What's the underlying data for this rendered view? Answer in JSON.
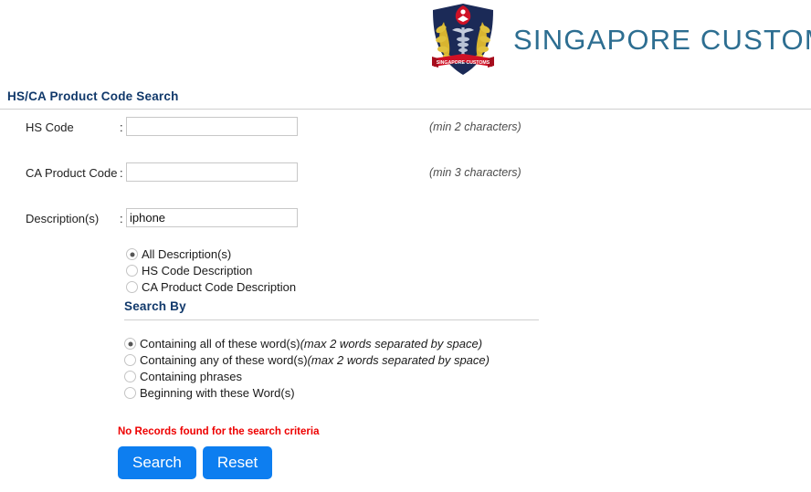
{
  "brand": {
    "name": "SINGAPORE CUSTOMS",
    "crest_icon": "singapore-customs-crest-icon",
    "crest_banner_text": "SINGAPORE CUSTOMS",
    "accent_color": "#2d6e91"
  },
  "page": {
    "title": "HS/CA Product Code Search",
    "heading_color": "#11396b"
  },
  "form": {
    "fields": [
      {
        "label": "HS Code",
        "separator": ":",
        "value": "",
        "placeholder": "",
        "hint": "(min 2 characters)"
      },
      {
        "label": "CA Product Code",
        "separator": ":",
        "value": "",
        "placeholder": "",
        "hint": "(min 3 characters)"
      },
      {
        "label": "Description(s)",
        "separator": ":",
        "value": "iphone",
        "placeholder": "",
        "hint": ""
      }
    ],
    "description_scope": {
      "options": [
        {
          "label": "All Description(s)",
          "checked": true
        },
        {
          "label": "HS Code Description",
          "checked": false
        },
        {
          "label": "CA Product Code Description",
          "checked": false
        }
      ]
    }
  },
  "search_by": {
    "title": "Search By",
    "options": [
      {
        "label": "Containing all of these word(s)",
        "hint": "(max 2 words separated by space)",
        "checked": true
      },
      {
        "label": "Containing any of these word(s)",
        "hint": "(max 2 words separated by space)",
        "checked": false
      },
      {
        "label": "Containing phrases",
        "hint": "",
        "checked": false
      },
      {
        "label": "Beginning with these Word(s)",
        "hint": "",
        "checked": false
      }
    ]
  },
  "status": {
    "message": "No Records found for the search criteria",
    "message_color": "#ee0000"
  },
  "buttons": {
    "search_label": "Search",
    "reset_label": "Reset",
    "color": "#0d7ef0"
  }
}
